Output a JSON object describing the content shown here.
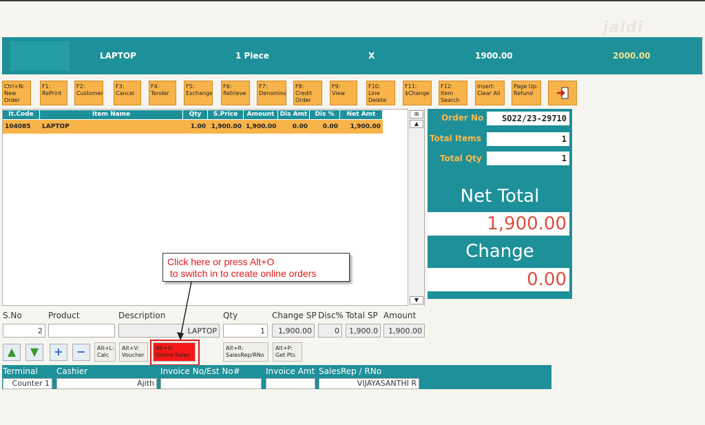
{
  "watermark": "jaldi",
  "banner": {
    "item": "LAPTOP",
    "qty": "1 Piece",
    "x": "X",
    "price": "1900.00",
    "total": "2000.00"
  },
  "toolbar": [
    {
      "l1": "Ctrl+N:",
      "l2": "New",
      "l3": "Order"
    },
    {
      "l1": "F1:",
      "l2": "RePrint",
      "l3": ""
    },
    {
      "l1": "F2:",
      "l2": "Customer",
      "l3": ""
    },
    {
      "l1": "F3:",
      "l2": "Cancel",
      "l3": ""
    },
    {
      "l1": "F4:",
      "l2": "Tender",
      "l3": ""
    },
    {
      "l1": "F5:",
      "l2": "Exchange",
      "l3": ""
    },
    {
      "l1": "F6:",
      "l2": "Retrieve",
      "l3": ""
    },
    {
      "l1": "F7:",
      "l2": "Denomina",
      "l3": ""
    },
    {
      "l1": "F8:",
      "l2": "Credit",
      "l3": "Order"
    },
    {
      "l1": "F9:",
      "l2": "View",
      "l3": ""
    },
    {
      "l1": "F10:",
      "l2": "Line",
      "l3": "Delete"
    },
    {
      "l1": "F11:",
      "l2": "$Change",
      "l3": ""
    },
    {
      "l1": "F12:",
      "l2": "Item",
      "l3": "Search"
    },
    {
      "l1": "Insert:",
      "l2": "Clear All",
      "l3": ""
    },
    {
      "l1": "Page Up:",
      "l2": "Refund",
      "l3": ""
    }
  ],
  "grid": {
    "headers": [
      "It.Code",
      "Item Name",
      "Qty",
      "S.Price",
      "Amount",
      "Dis Amt",
      "Dis %",
      "Net Amt"
    ],
    "row": [
      "104085",
      "LAPTOP",
      "1.00",
      "1,900.00",
      "1,900.00",
      "0.00",
      "0.00",
      "1,900.00"
    ]
  },
  "panel": {
    "order_label": "Order No",
    "order_value": "SO22/23-29710",
    "items_label": "Total Items",
    "items_value": "1",
    "qty_label": "Total Qty",
    "qty_value": "1",
    "net_label": "Net Total",
    "net_value": "1,900.00",
    "change_label": "Change",
    "change_value": "0.00"
  },
  "entry": {
    "labels": [
      "S.No",
      "Product",
      "Description",
      "Qty",
      "Change SP",
      "Disc%",
      "Total SP",
      "Amount"
    ],
    "sno": "2",
    "product": "",
    "description": "LAPTOP",
    "qty": "1",
    "change_sp": "1,900.00",
    "disc": "0",
    "total_sp": "1,900.0",
    "amount": "1,900.00"
  },
  "buttons": {
    "calc": {
      "l1": "Alt+L:",
      "l2": "Calc"
    },
    "voucher": {
      "l1": "Alt+V:",
      "l2": "Voucher"
    },
    "online": {
      "l1": "Alt+O:",
      "l2": "Online Sales"
    },
    "salesrep": {
      "l1": "Alt+R:",
      "l2": "SalesRep/RNo"
    },
    "getpts": {
      "l1": "Alt+P:",
      "l2": "Get Pts"
    }
  },
  "footer": {
    "labels": [
      "Terminal",
      "Cashier",
      "Invoice No/Est No#",
      "Invoice Amt",
      "SalesRep / RNo"
    ],
    "terminal": "Counter 1",
    "cashier": "Ajith",
    "invoice_no": "",
    "invoice_amt": "",
    "salesrep": "VIJAYASANTHI R"
  },
  "callout": {
    "line1": "Click here or press Alt+O",
    "line2": " to switch in to create online orders"
  },
  "colors": {
    "teal": "#1e9099",
    "orange": "#f8b34a",
    "red": "#e01818"
  }
}
